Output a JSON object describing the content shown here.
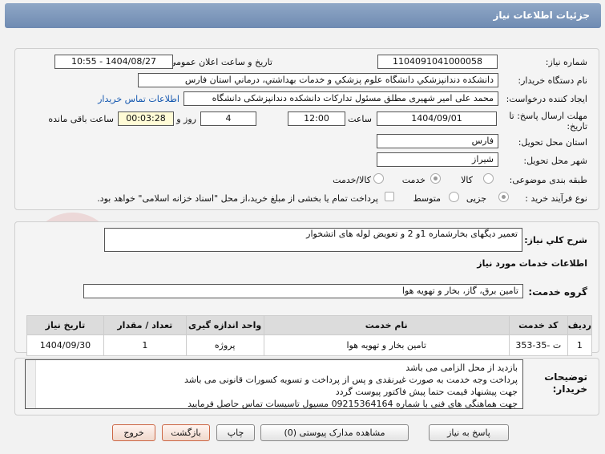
{
  "title": "جزئیات اطلاعات نیاز",
  "need_number": {
    "label": "شماره نیاز:",
    "value": "1104091041000058"
  },
  "announce": {
    "label": "تاریخ و ساعت اعلان عمومی:",
    "value": "1404/08/27 - 10:55"
  },
  "buyer": {
    "label": "نام دستگاه خریدار:",
    "value": "دانشکده دندانپزشکي دانشگاه علوم پزشکي و خدمات بهداشتي، درماني استان فارس"
  },
  "creator": {
    "label": "ایجاد کننده درخواست:",
    "value": "محمد علی امیر شهیری مطلق مسئول تدارکات دانشکده دندانپزشکی دانشگاه",
    "link": "اطلاعات تماس خریدار"
  },
  "deadline": {
    "label": "مهلت ارسال پاسخ: تا تاریخ:",
    "date": "1404/09/01",
    "time_label": "ساعت",
    "time": "12:00",
    "days": "4",
    "days_label": "روز و",
    "remaining": "00:03:28",
    "remaining_label": "ساعت باقی مانده"
  },
  "province": {
    "label": "استان محل تحویل:",
    "value": "فارس"
  },
  "city": {
    "label": "شهر محل تحویل:",
    "value": "شیراز"
  },
  "category": {
    "label": "طبقه بندی موضوعی:",
    "options": [
      "کالا",
      "خدمت",
      "کالا/خدمت"
    ],
    "selected": "خدمت"
  },
  "purchase_type": {
    "label": "نوع فرآیند خرید :",
    "options": [
      "جزیی",
      "متوسط"
    ],
    "selected": "جزیی",
    "note": "پرداخت تمام یا بخشی از مبلغ خرید،از محل \"اسناد خزانه اسلامی\" خواهد بود."
  },
  "description": {
    "label": "شرح کلي نیاز:",
    "value": "تعمیر دیگهای بخارشماره 1و 2 و تعویض لوله های اتشخوار"
  },
  "services_heading": "اطلاعات خدمات مورد نیاز",
  "service_group": {
    "label": "گروه خدمت:",
    "value": "تامین برق، گاز، بخار و تهویه هوا"
  },
  "table": {
    "headers": [
      "ردیف",
      "کد خدمت",
      "نام خدمت",
      "واحد اندازه گیری",
      "تعداد / مقدار",
      "تاریخ نیاز"
    ],
    "rows": [
      [
        "1",
        "ت -35-353",
        "تامین بخار و تهویه هوا",
        "پروژه",
        "1",
        "1404/09/30"
      ]
    ]
  },
  "buyer_notes": {
    "label": "توضیحات خریدار:",
    "lines": [
      "بازدید از محل الزامی می باشد",
      "پرداخت وجه خدمت به صورت غیرنقدی و پس از پرداخت و تسویه کسورات قانونی می باشد",
      "جهت پیشنهاد قیمت حتما پیش فاکتور پیوست گردد",
      "جهت هماهنگی های فنی با شماره 09215364164 مسیول تاسیسات تماس حاصل فرمایید"
    ]
  },
  "buttons": {
    "reply": "پاسخ به نیاز",
    "attachments": "مشاهده مدارک پیوستی (0)",
    "print": "چاپ",
    "back": "بازگشت",
    "exit": "خروج"
  },
  "watermark": "AriaTender.net"
}
